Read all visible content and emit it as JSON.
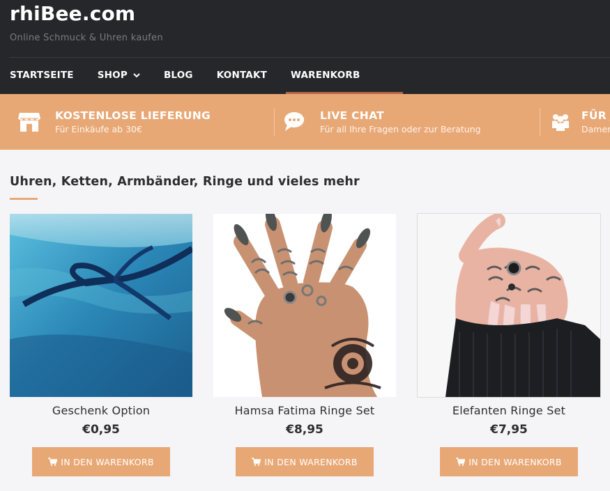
{
  "site": {
    "title": "rhiBee.com",
    "tagline": "Online Schmuck & Uhren kaufen"
  },
  "nav": {
    "items": [
      {
        "label": "STARTSEITE"
      },
      {
        "label": "SHOP",
        "has_dropdown": true
      },
      {
        "label": "BLOG"
      },
      {
        "label": "KONTAKT"
      },
      {
        "label": "WARENKORB"
      }
    ]
  },
  "features": [
    {
      "icon": "store-icon",
      "title": "KOSTENLOSE LIEFERUNG",
      "subtitle": "Für Einkäufe ab 30€"
    },
    {
      "icon": "chat-icon",
      "title": "LIVE CHAT",
      "subtitle": "Für all Ihre Fragen oder zur Beratung"
    },
    {
      "icon": "group-icon",
      "title": "FÜR JEDEN",
      "subtitle": "Damen, Herren"
    }
  ],
  "section": {
    "title": "Uhren, Ketten, Armbänder, Ringe und vieles mehr"
  },
  "products": [
    {
      "name": "Geschenk Option",
      "price": "€0,95",
      "button": "IN DEN WARENKORB",
      "image": "blue-gift-ribbon-photo"
    },
    {
      "name": "Hamsa Fatima Ringe Set",
      "price": "€8,95",
      "button": "IN DEN WARENKORB",
      "image": "hand-with-silver-rings-photo"
    },
    {
      "name": "Elefanten Ringe Set",
      "price": "€7,95",
      "button": "IN DEN WARENKORB",
      "image": "hand-with-rings-black-sweater-photo"
    }
  ],
  "colors": {
    "header_bg": "#26272b",
    "accent": "#e8a876",
    "page_bg": "#f5f5f8",
    "text": "#2d2d31"
  }
}
